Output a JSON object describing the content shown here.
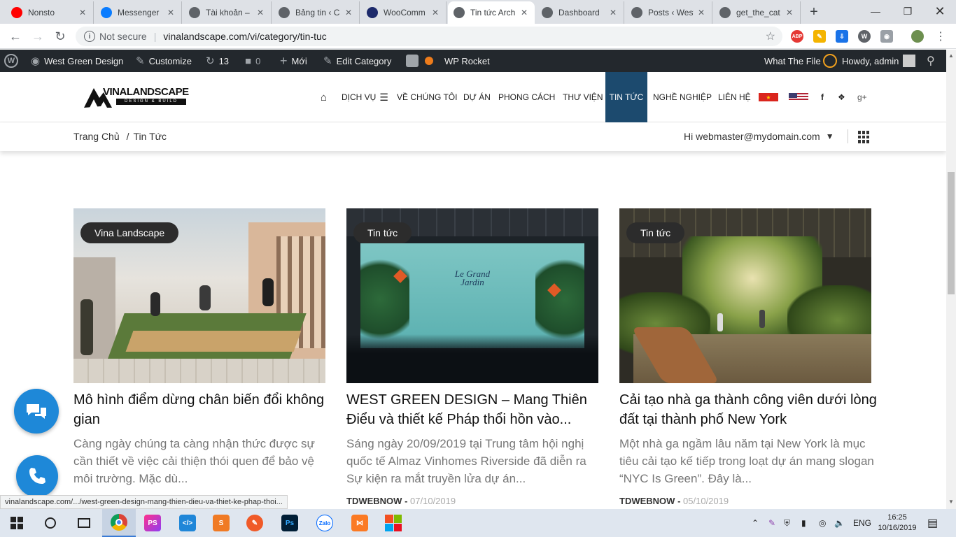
{
  "browser": {
    "tabs": [
      {
        "label": "Nonsto",
        "icon": "youtube-icon",
        "color": "#ff0000"
      },
      {
        "label": "Messenger",
        "icon": "messenger-icon",
        "color": "#0a7cff"
      },
      {
        "label": "Tài khoản –",
        "icon": "wordpress-icon",
        "color": "#5f6368"
      },
      {
        "label": "Bảng tin ‹ C",
        "icon": "wordpress-icon",
        "color": "#5f6368"
      },
      {
        "label": "WooComm",
        "icon": "bootstrap-b-icon",
        "color": "#1d2a6b"
      },
      {
        "label": "Tin tức Arch",
        "icon": "globe-icon",
        "color": "#5f6368"
      },
      {
        "label": "Dashboard",
        "icon": "globe-icon",
        "color": "#5f6368"
      },
      {
        "label": "Posts ‹ West",
        "icon": "globe-icon",
        "color": "#5f6368"
      },
      {
        "label": "get_the_cat",
        "icon": "wordpress-icon",
        "color": "#5f6368"
      }
    ],
    "new_tab": "+",
    "security_label": "Not secure",
    "url": "vinalandscape.com/vi/category/tin-tuc",
    "status_url": "vinalandscape.com/.../west-green-design-mang-thien-dieu-va-thiet-ke-phap-thoi..."
  },
  "adminbar": {
    "site_name": "West Green Design",
    "customize": "Customize",
    "updates_count": "13",
    "comments_count": "0",
    "new_label": "Mới",
    "edit_category": "Edit Category",
    "wp_rocket": "WP Rocket",
    "what_the_file": "What The File",
    "howdy": "Howdy, admin"
  },
  "site": {
    "logo_text": "VINALANDSCAPE",
    "logo_sub": "DESIGN & BUILD",
    "nav": [
      "DỊCH VỤ",
      "VỀ CHÚNG TÔI",
      "DỰ ÁN",
      "PHONG CÁCH",
      "THƯ VIỆN",
      "TIN TỨC",
      "NGHỀ NGHIỆP",
      "LIÊN HỆ"
    ],
    "active_nav": "TIN TỨC",
    "accent": "#1c4a6e"
  },
  "breadcrumb": {
    "home": "Trang Chủ",
    "separator": "/",
    "current": "Tin Tức",
    "user": "Hi webmaster@mydomain.com"
  },
  "page": {
    "title": "Tin tức",
    "cards": [
      {
        "badge": "Vina Landscape",
        "title": "Mô hình điểm dừng chân biến đổi không gian",
        "excerpt": "Càng ngày chúng ta càng nhận thức được sự cần thiết về việc cải thiện thói quen để bảo vệ môi trường. Mặc dù...",
        "author": "",
        "date": ""
      },
      {
        "badge": "Tin tức",
        "title": "WEST GREEN DESIGN – Mang Thiên Điểu và thiết kế Pháp thổi hồn vào...",
        "excerpt": "Sáng ngày 20/09/2019 tại Trung tâm hội nghị quốc tế Almaz Vinhomes Riverside đã diễn ra Sự kiện ra mắt truyền lửa dự án...",
        "image_text": "Le Grand Jardin",
        "author": "TDWEBNOW",
        "date": "07/10/2019"
      },
      {
        "badge": "Tin tức",
        "title": "Cải tạo nhà ga thành công viên dưới lòng đất tại thành phố New York",
        "excerpt": "Một nhà ga ngầm lâu năm tại New York là mục tiêu cải tạo kế tiếp trong loạt dự án mang slogan “NYC Is Green”. Đây là...",
        "author": "TDWEBNOW",
        "date": "05/10/2019"
      }
    ],
    "meta_sep": "-"
  },
  "taskbar": {
    "lang": "ENG",
    "time": "16:25",
    "date": "10/16/2019"
  }
}
